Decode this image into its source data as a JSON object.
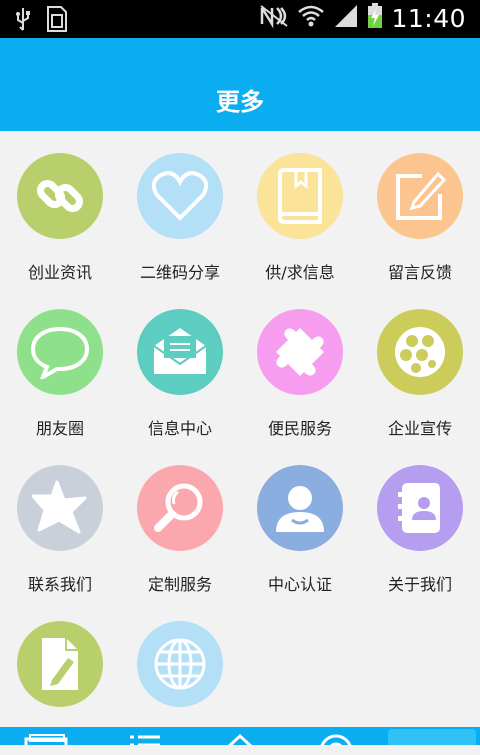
{
  "status": {
    "time": "11:40"
  },
  "header": {
    "title": "更多"
  },
  "items": [
    {
      "label": "创业资讯",
      "icon": "link-icon",
      "color": "#b8cf6c"
    },
    {
      "label": "二维码分享",
      "icon": "heart-icon",
      "color": "#b3e0f7"
    },
    {
      "label": "供/求信息",
      "icon": "book-icon",
      "color": "#fbe39a"
    },
    {
      "label": "留言反馈",
      "icon": "edit-icon",
      "color": "#fcc58f"
    },
    {
      "label": "朋友圈",
      "icon": "chat-bubble-icon",
      "color": "#8fe08a"
    },
    {
      "label": "信息中心",
      "icon": "envelope-icon",
      "color": "#5ccdc0"
    },
    {
      "label": "便民服务",
      "icon": "puzzle-icon",
      "color": "#f79df0"
    },
    {
      "label": "企业宣传",
      "icon": "film-reel-icon",
      "color": "#cccc5a"
    },
    {
      "label": "联系我们",
      "icon": "star-icon",
      "color": "#c9d0da"
    },
    {
      "label": "定制服务",
      "icon": "magnifier-icon",
      "color": "#fba7ae"
    },
    {
      "label": "中心认证",
      "icon": "user-icon",
      "color": "#8aaee0"
    },
    {
      "label": "关于我们",
      "icon": "contacts-book-icon",
      "color": "#b59df0"
    },
    {
      "label": "",
      "icon": "document-pen-icon",
      "color": "#b8cf6c"
    },
    {
      "label": "",
      "icon": "globe-icon",
      "color": "#b3e0f7"
    }
  ],
  "tabbar": {
    "icons": [
      "document-icon",
      "list-icon",
      "home-icon",
      "location-icon",
      "more-icon"
    ]
  }
}
